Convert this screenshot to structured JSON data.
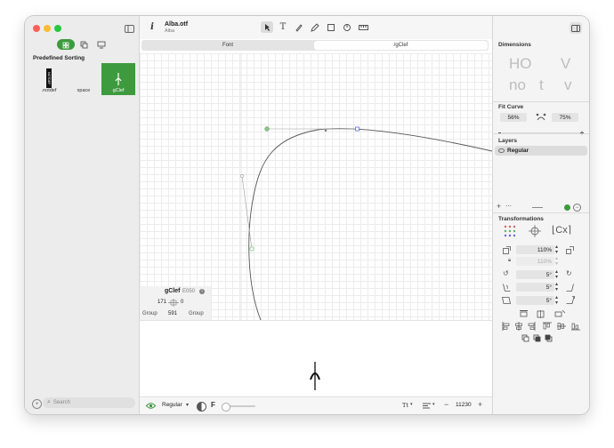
{
  "window": {
    "file_name": "Alba.otf",
    "family_name": "Alba"
  },
  "tabs": [
    {
      "label": "Font"
    },
    {
      "label": "/gClef"
    }
  ],
  "sidebar": {
    "section_title": "Predefined Sorting",
    "glyphs": [
      {
        "name": ".notdef",
        "thumb_text": "NOTDEF"
      },
      {
        "name": "space",
        "thumb_text": ""
      },
      {
        "name": "gClef",
        "thumb_text": "",
        "selected": true
      }
    ],
    "search_placeholder": "Search"
  },
  "glyph_info": {
    "name": "gClef",
    "unicode": "E050",
    "lsb": "171",
    "rsb": "0",
    "left_group": "Group",
    "width": "591",
    "right_group": "Group"
  },
  "bottom_bar": {
    "master": "Regular",
    "features_glyph": "F",
    "text_size_glyph": "Tt",
    "zoom": "11230"
  },
  "right_panel": {
    "dimensions_title": "Dimensions",
    "dim_samples": [
      "HO",
      "V",
      "no",
      "t",
      "v"
    ],
    "fit_curve_title": "Fit Curve",
    "fit_left": "56%",
    "fit_right": "75%",
    "layers_title": "Layers",
    "layers": [
      {
        "name": "Regular"
      }
    ],
    "transformations_title": "Transformations",
    "transform_text": "Cx",
    "scale_x": "110%",
    "scale_y": "110%",
    "rotate": "5°",
    "skew": "5°",
    "slant": "5°"
  },
  "colors": {
    "accent_green": "#3e9a3e",
    "handle_green": "#8cc38c",
    "handle_blue": "#5b6ee0"
  }
}
